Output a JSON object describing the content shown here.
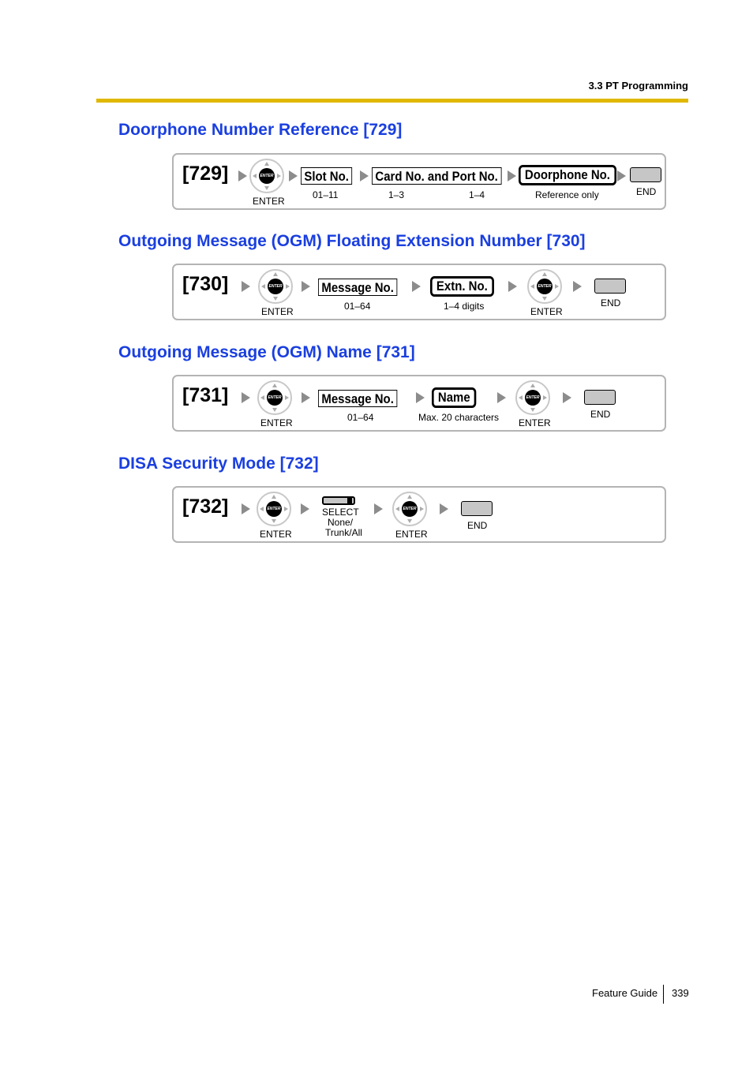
{
  "header": {
    "section": "3.3 PT Programming"
  },
  "sections": [
    {
      "title": "Doorphone Number Reference [729]",
      "code": "[729]",
      "enter_label": "ENTER",
      "fields": [
        {
          "label": "Slot No.",
          "note": "01–11"
        },
        {
          "label": "Card No. and Port No.",
          "note_a": "1–3",
          "note_b": "1–4"
        },
        {
          "label": "Doorphone No.",
          "note": "Reference only"
        }
      ],
      "end_label": "END"
    },
    {
      "title": "Outgoing Message (OGM) Floating Extension Number [730]",
      "code": "[730]",
      "enter_label": "ENTER",
      "fields": [
        {
          "label": "Message No.",
          "note": "01–64"
        },
        {
          "label": "Extn. No.",
          "note": "1–4 digits"
        }
      ],
      "enter2_label": "ENTER",
      "end_label": "END"
    },
    {
      "title": "Outgoing Message (OGM) Name [731]",
      "code": "[731]",
      "enter_label": "ENTER",
      "fields": [
        {
          "label": "Message No.",
          "note": "01–64"
        },
        {
          "label": "Name",
          "note": "Max. 20 characters"
        }
      ],
      "enter2_label": "ENTER",
      "end_label": "END"
    },
    {
      "title": "DISA Security Mode [732]",
      "code": "[732]",
      "enter_label": "ENTER",
      "select_label": "SELECT",
      "select_options_line1": "None/",
      "select_options_line2": "Trunk/All",
      "enter2_label": "ENTER",
      "end_label": "END"
    }
  ],
  "footer": {
    "doc": "Feature Guide",
    "page": "339"
  },
  "pad_text": "ENTER"
}
